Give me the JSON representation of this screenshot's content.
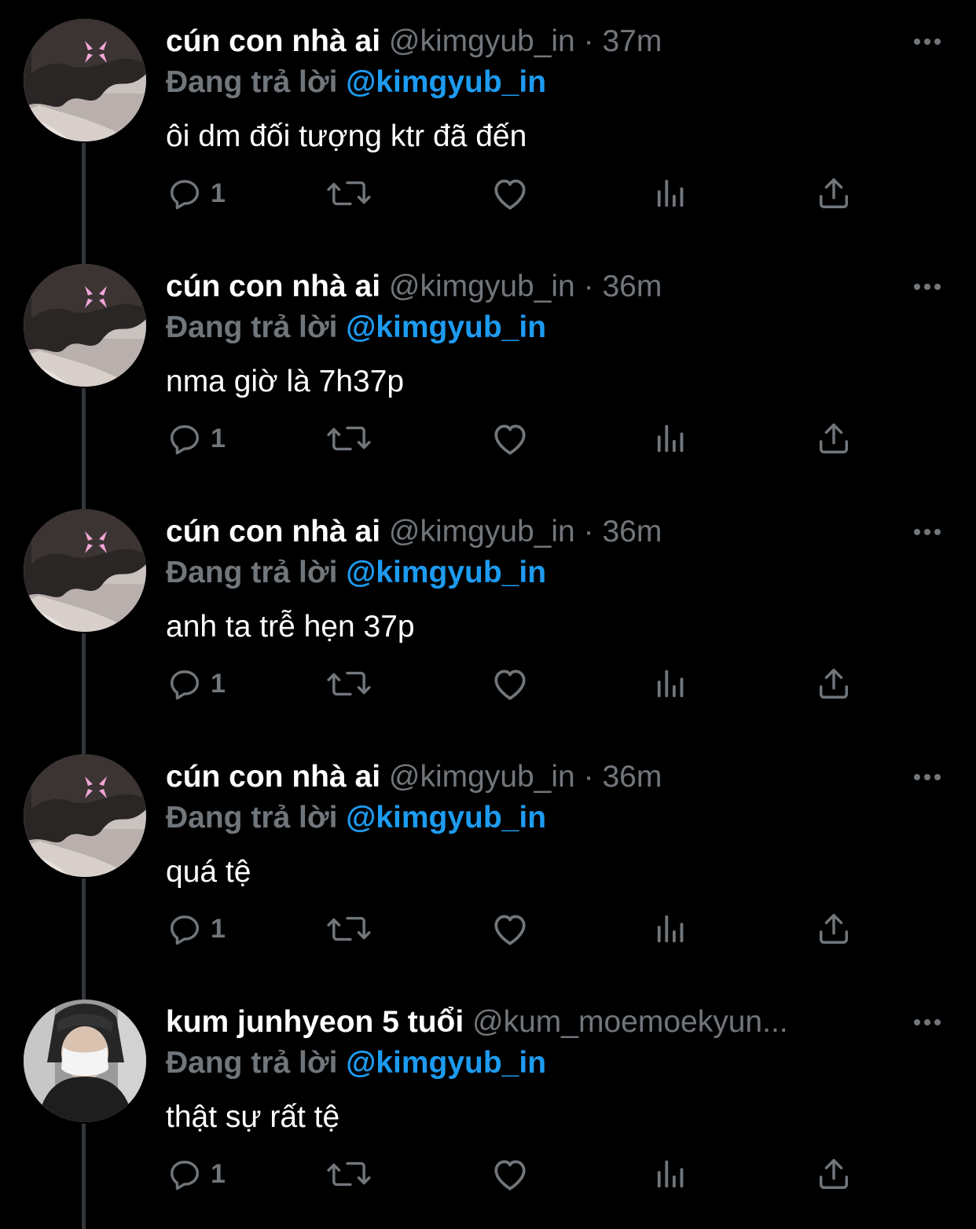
{
  "theme": {
    "background": "#000000",
    "name_color": "#ffffff",
    "muted_color": "#71767b",
    "mention_color": "#1d9bf0",
    "thread_line_color": "#333639"
  },
  "tweets": [
    {
      "display_name": "cún con nhà ai",
      "handle": "@kimgyub_in",
      "separator": "·",
      "time": "37m",
      "reply_prefix": "Đang trả lời",
      "reply_to": "@kimgyub_in",
      "text": "ôi dm đối tượng ktr đã đến",
      "reply_count": "1",
      "avatar_icon": "anime-boy-avatar"
    },
    {
      "display_name": "cún con nhà ai",
      "handle": "@kimgyub_in",
      "separator": "·",
      "time": "36m",
      "reply_prefix": "Đang trả lời",
      "reply_to": "@kimgyub_in",
      "text": "nma giờ là 7h37p",
      "reply_count": "1",
      "avatar_icon": "anime-boy-avatar"
    },
    {
      "display_name": "cún con nhà ai",
      "handle": "@kimgyub_in",
      "separator": "·",
      "time": "36m",
      "reply_prefix": "Đang trả lời",
      "reply_to": "@kimgyub_in",
      "text": "anh ta trễ hẹn 37p",
      "reply_count": "1",
      "avatar_icon": "anime-boy-avatar"
    },
    {
      "display_name": "cún con nhà ai",
      "handle": "@kimgyub_in",
      "separator": "·",
      "time": "36m",
      "reply_prefix": "Đang trả lời",
      "reply_to": "@kimgyub_in",
      "text": "quá tệ",
      "reply_count": "1",
      "avatar_icon": "anime-boy-avatar"
    },
    {
      "display_name": "kum junhyeon 5 tuổi",
      "handle": "@kum_moemoekyun...",
      "separator": "",
      "time": "",
      "reply_prefix": "Đang trả lời",
      "reply_to": "@kimgyub_in",
      "text": "thật sự rất tệ",
      "reply_count": "1",
      "avatar_icon": "masked-person-avatar"
    }
  ],
  "icons": {
    "reply": "comment-bubble-icon",
    "retweet": "retweet-arrows-icon",
    "like": "heart-outline-icon",
    "views": "bar-chart-icon",
    "share": "share-upload-icon",
    "more": "more-dots-icon"
  }
}
